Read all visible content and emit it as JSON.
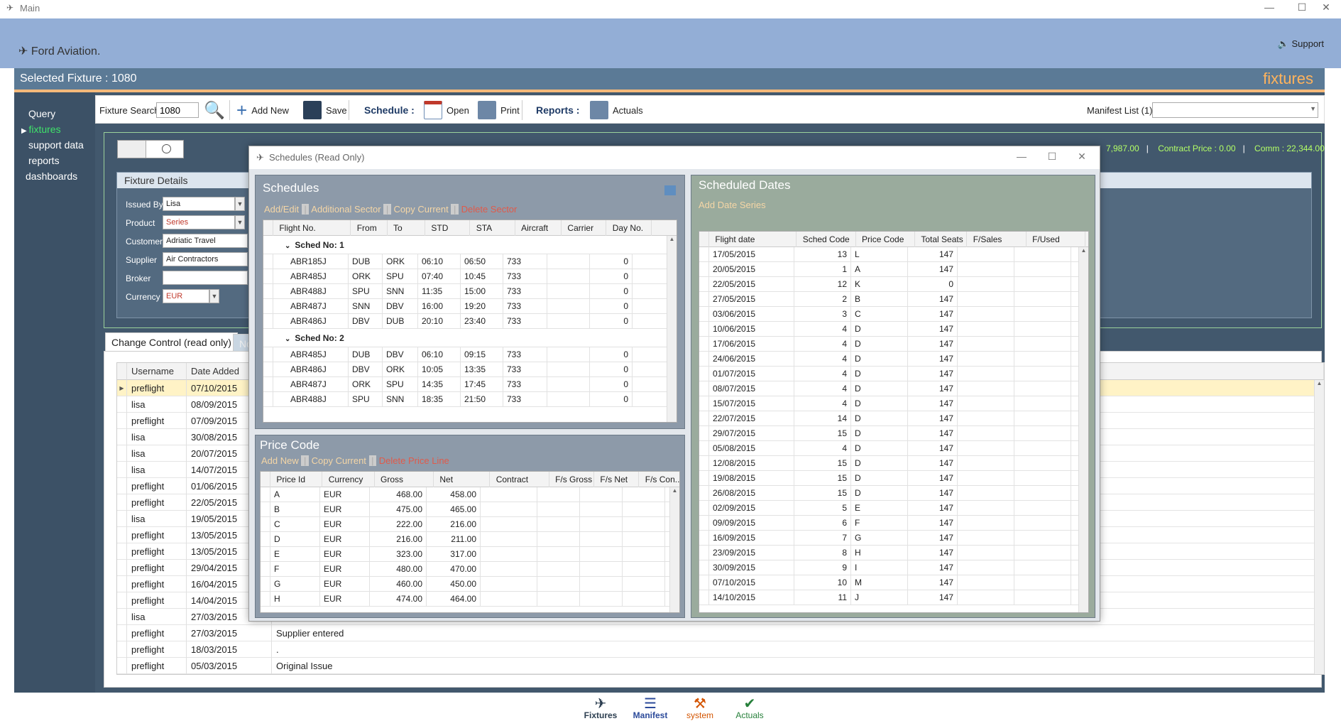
{
  "window": {
    "title": "Main",
    "support_label": "Support"
  },
  "brand": "Ford Aviation.",
  "selected_fixture": "Selected Fixture : 1080",
  "module_title": "fixtures",
  "nav": [
    "Query",
    "fixtures",
    "support data",
    "reports",
    "dashboards"
  ],
  "toolbar": {
    "fixture_search_label": "Fixture Search",
    "fixture_search_value": "1080",
    "add_new": "Add New",
    "save": "Save",
    "schedule_label": "Schedule :",
    "open": "Open",
    "print": "Print",
    "reports_label": "Reports :",
    "actuals": "Actuals",
    "manifest_label": "Manifest List (1)"
  },
  "stats": {
    "a": "7,987.00",
    "contract_price": "Contract Price : 0.00",
    "comm": "Comm : 22,344.00"
  },
  "fixture_details": {
    "title": "Fixture Details",
    "fields": [
      {
        "label": "Issued By",
        "value": "Lisa"
      },
      {
        "label": "Product",
        "value": "Series"
      },
      {
        "label": "Customer",
        "value": "Adriatic Travel"
      },
      {
        "label": "Supplier",
        "value": "Air Contractors"
      },
      {
        "label": "Broker",
        "value": ""
      },
      {
        "label": "Currency",
        "value": "EUR"
      }
    ]
  },
  "tabs": [
    "Change Control (read only)",
    "No"
  ],
  "change_control": {
    "headers": [
      "Username",
      "Date Added"
    ],
    "rows": [
      [
        "preflight",
        "07/10/2015",
        ""
      ],
      [
        "lisa",
        "08/09/2015",
        ""
      ],
      [
        "preflight",
        "07/09/2015",
        ""
      ],
      [
        "lisa",
        "30/08/2015",
        ""
      ],
      [
        "lisa",
        "20/07/2015",
        ""
      ],
      [
        "lisa",
        "14/07/2015",
        ""
      ],
      [
        "preflight",
        "01/06/2015",
        ""
      ],
      [
        "preflight",
        "22/05/2015",
        ""
      ],
      [
        "lisa",
        "19/05/2015",
        ""
      ],
      [
        "preflight",
        "13/05/2015",
        ""
      ],
      [
        "preflight",
        "13/05/2015",
        ""
      ],
      [
        "preflight",
        "29/04/2015",
        ""
      ],
      [
        "preflight",
        "16/04/2015",
        ""
      ],
      [
        "preflight",
        "14/04/2015",
        ""
      ],
      [
        "lisa",
        "27/03/2015",
        ""
      ],
      [
        "preflight",
        "27/03/2015",
        "Supplier entered"
      ],
      [
        "preflight",
        "18/03/2015",
        "."
      ],
      [
        "preflight",
        "05/03/2015",
        "Original Issue"
      ]
    ]
  },
  "modal": {
    "title": "Schedules (Read Only)",
    "schedules": {
      "title": "Schedules",
      "actions": [
        "Add/Edit",
        "Additional Sector",
        "Copy Current",
        "Delete Sector"
      ],
      "headers": [
        "Flight No.",
        "From",
        "To",
        "STD",
        "STA",
        "Aircraft",
        "Carrier",
        "Day No."
      ],
      "groups": [
        {
          "name": "Sched No: 1",
          "rows": [
            [
              "ABR185J",
              "DUB",
              "ORK",
              "06:10",
              "06:50",
              "733",
              "",
              "0"
            ],
            [
              "ABR485J",
              "ORK",
              "SPU",
              "07:40",
              "10:45",
              "733",
              "",
              "0"
            ],
            [
              "ABR488J",
              "SPU",
              "SNN",
              "11:35",
              "15:00",
              "733",
              "",
              "0"
            ],
            [
              "ABR487J",
              "SNN",
              "DBV",
              "16:00",
              "19:20",
              "733",
              "",
              "0"
            ],
            [
              "ABR486J",
              "DBV",
              "DUB",
              "20:10",
              "23:40",
              "733",
              "",
              "0"
            ]
          ]
        },
        {
          "name": "Sched No: 2",
          "rows": [
            [
              "ABR485J",
              "DUB",
              "DBV",
              "06:10",
              "09:15",
              "733",
              "",
              "0"
            ],
            [
              "ABR486J",
              "DBV",
              "ORK",
              "10:05",
              "13:35",
              "733",
              "",
              "0"
            ],
            [
              "ABR487J",
              "ORK",
              "SPU",
              "14:35",
              "17:45",
              "733",
              "",
              "0"
            ],
            [
              "ABR488J",
              "SPU",
              "SNN",
              "18:35",
              "21:50",
              "733",
              "",
              "0"
            ]
          ]
        }
      ]
    },
    "price_code": {
      "title": "Price Code",
      "actions": [
        "Add New",
        "Copy Current",
        "Delete Price Line"
      ],
      "headers": [
        "Price Id",
        "Currency",
        "Gross",
        "Net",
        "Contract",
        "F/s Gross",
        "F/s Net",
        "F/s Con..."
      ],
      "rows": [
        [
          "A",
          "EUR",
          "468.00",
          "458.00"
        ],
        [
          "B",
          "EUR",
          "475.00",
          "465.00"
        ],
        [
          "C",
          "EUR",
          "222.00",
          "216.00"
        ],
        [
          "D",
          "EUR",
          "216.00",
          "211.00"
        ],
        [
          "E",
          "EUR",
          "323.00",
          "317.00"
        ],
        [
          "F",
          "EUR",
          "480.00",
          "470.00"
        ],
        [
          "G",
          "EUR",
          "460.00",
          "450.00"
        ],
        [
          "H",
          "EUR",
          "474.00",
          "464.00"
        ]
      ]
    },
    "scheduled_dates": {
      "title": "Scheduled Dates",
      "actions": [
        "Add Date Series"
      ],
      "headers": [
        "Flight date",
        "Sched Code",
        "Price Code",
        "Total Seats",
        "F/Sales",
        "F/Used"
      ],
      "rows": [
        [
          "17/05/2015",
          "13",
          "L",
          "147"
        ],
        [
          "20/05/2015",
          "1",
          "A",
          "147"
        ],
        [
          "22/05/2015",
          "12",
          "K",
          "0"
        ],
        [
          "27/05/2015",
          "2",
          "B",
          "147"
        ],
        [
          "03/06/2015",
          "3",
          "C",
          "147"
        ],
        [
          "10/06/2015",
          "4",
          "D",
          "147"
        ],
        [
          "17/06/2015",
          "4",
          "D",
          "147"
        ],
        [
          "24/06/2015",
          "4",
          "D",
          "147"
        ],
        [
          "01/07/2015",
          "4",
          "D",
          "147"
        ],
        [
          "08/07/2015",
          "4",
          "D",
          "147"
        ],
        [
          "15/07/2015",
          "4",
          "D",
          "147"
        ],
        [
          "22/07/2015",
          "14",
          "D",
          "147"
        ],
        [
          "29/07/2015",
          "15",
          "D",
          "147"
        ],
        [
          "05/08/2015",
          "4",
          "D",
          "147"
        ],
        [
          "12/08/2015",
          "15",
          "D",
          "147"
        ],
        [
          "19/08/2015",
          "15",
          "D",
          "147"
        ],
        [
          "26/08/2015",
          "15",
          "D",
          "147"
        ],
        [
          "02/09/2015",
          "5",
          "E",
          "147"
        ],
        [
          "09/09/2015",
          "6",
          "F",
          "147"
        ],
        [
          "16/09/2015",
          "7",
          "G",
          "147"
        ],
        [
          "23/09/2015",
          "8",
          "H",
          "147"
        ],
        [
          "30/09/2015",
          "9",
          "I",
          "147"
        ],
        [
          "07/10/2015",
          "10",
          "M",
          "147"
        ],
        [
          "14/10/2015",
          "11",
          "J",
          "147"
        ]
      ]
    }
  },
  "bottom_nav": [
    {
      "label": "Fixtures",
      "color": "#2c3e50"
    },
    {
      "label": "Manifest",
      "color": "#2b4a9a"
    },
    {
      "label": "system",
      "color": "#d35400"
    },
    {
      "label": "Actuals",
      "color": "#27803b"
    }
  ]
}
